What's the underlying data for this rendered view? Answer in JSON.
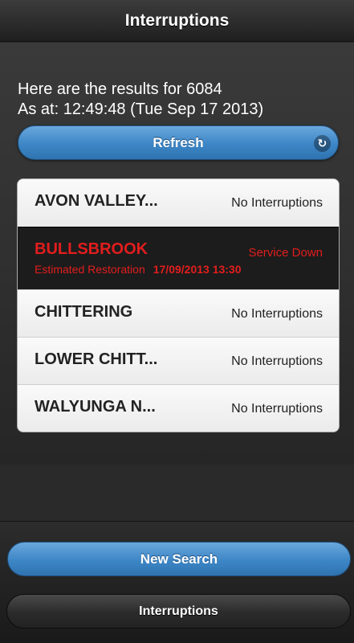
{
  "header": {
    "title": "Interruptions"
  },
  "results": {
    "line1": "Here are the results for 6084",
    "line2": "As at: 12:49:48 (Tue Sep 17 2013)"
  },
  "refresh": {
    "label": "Refresh",
    "icon": "refresh-icon"
  },
  "list": {
    "items": [
      {
        "name": "AVON VALLEY...",
        "status": "No Interruptions"
      },
      {
        "name": "BULLSBROOK",
        "status": "Service Down",
        "restoration_label": "Estimated Restoration",
        "restoration_time": "17/09/2013 13:30"
      },
      {
        "name": "CHITTERING",
        "status": "No Interruptions"
      },
      {
        "name": "LOWER CHITT...",
        "status": "No Interruptions"
      },
      {
        "name": "WALYUNGA N...",
        "status": "No Interruptions"
      }
    ]
  },
  "footer": {
    "new_search_label": "New Search",
    "interruptions_label": "Interruptions"
  },
  "colors": {
    "accent": "#3d86c6",
    "alert": "#e21d1d",
    "background": "#2a2a2a"
  }
}
